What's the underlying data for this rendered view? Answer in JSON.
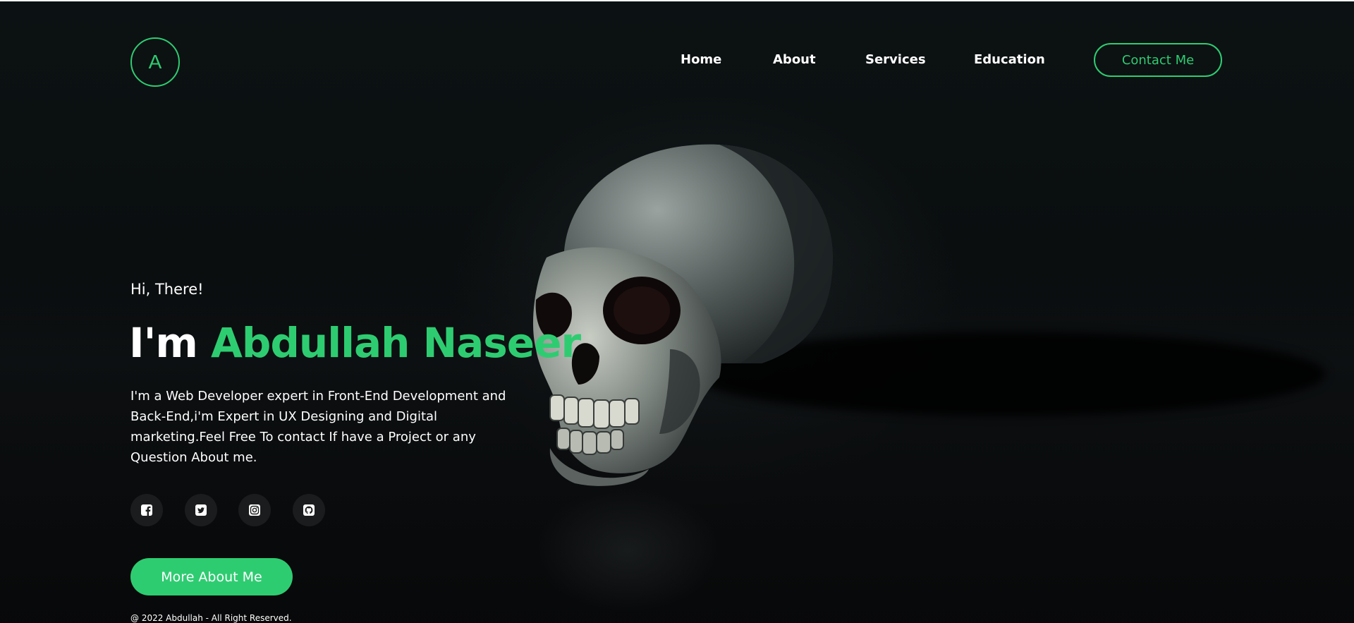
{
  "brand": {
    "logo_letter": "A",
    "accent_color": "#2ecc71"
  },
  "nav": {
    "items": [
      {
        "label": "Home"
      },
      {
        "label": "About"
      },
      {
        "label": "Services"
      },
      {
        "label": "Education"
      }
    ],
    "contact_label": "Contact Me"
  },
  "hero": {
    "greeting": "Hi, There!",
    "headline_prefix": "I'm",
    "name": "Abdullah Naseer",
    "bio": "I'm a Web Developer expert in Front-End Development and Back-End,i'm Expert in UX Designing and Digital marketing.Feel Free To contact If have a Project or any Question About me.",
    "socials": [
      {
        "icon": "facebook-icon"
      },
      {
        "icon": "twitter-icon"
      },
      {
        "icon": "instagram-icon"
      },
      {
        "icon": "github-icon"
      }
    ],
    "cta_label": "More About Me"
  },
  "footer": {
    "copyright": "@ 2022 Abdullah - All Right Reserved."
  }
}
